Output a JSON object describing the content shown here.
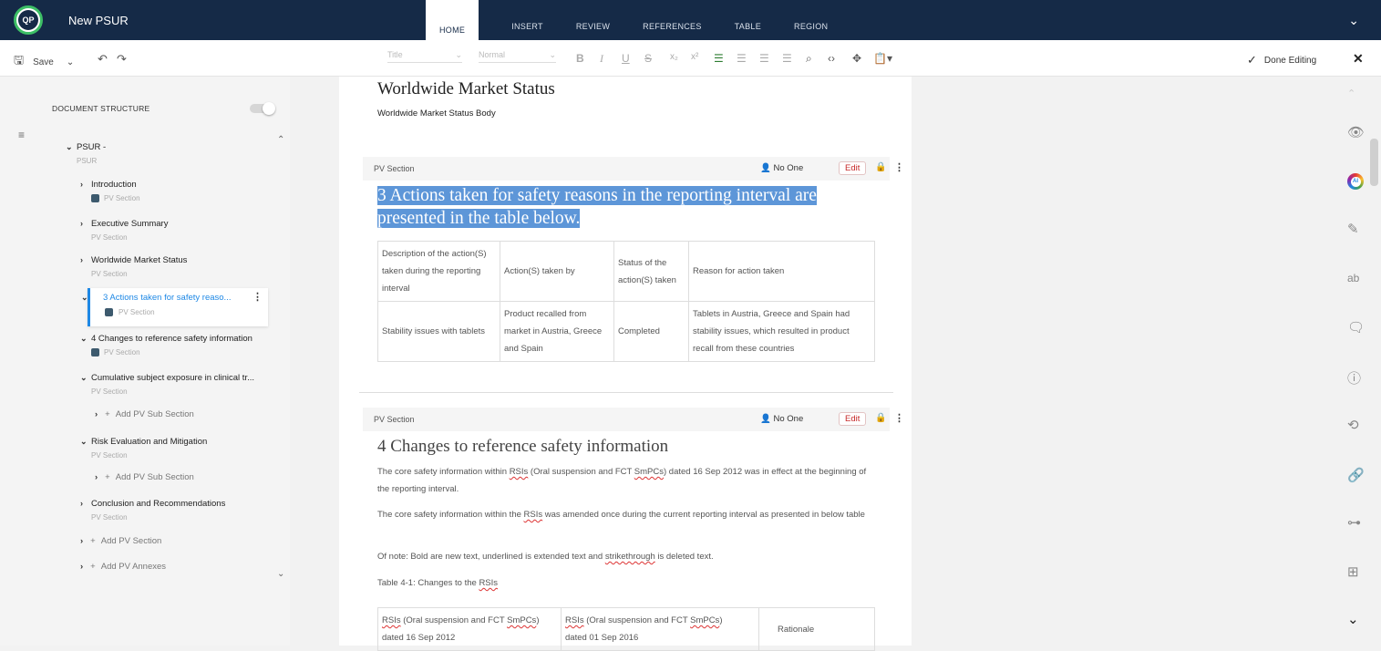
{
  "app": {
    "title": "New PSUR",
    "logo_text": "QP"
  },
  "tabs": [
    "HOME",
    "INSERT",
    "REVIEW",
    "REFERENCES",
    "TABLE",
    "REGION"
  ],
  "toolbar": {
    "save_label": "Save",
    "style_select": "Title",
    "para_select": "Normal",
    "done_label": "Done Editing"
  },
  "sidebar": {
    "header": "DOCUMENT STRUCTURE",
    "root": {
      "title": "PSUR -",
      "sub": "PSUR"
    },
    "items": [
      {
        "title": "Introduction",
        "sub": "PV Section"
      },
      {
        "title": "Executive Summary",
        "sub": "PV Section"
      },
      {
        "title": "Worldwide Market Status",
        "sub": "PV Section"
      },
      {
        "title": "3 Actions taken for safety reaso...",
        "sub": "PV Section"
      },
      {
        "title": "4 Changes to reference safety information",
        "sub": "PV Section"
      },
      {
        "title": "Cumulative subject exposure in clinical tr...",
        "sub": "PV Section"
      },
      {
        "title": "Risk Evaluation and Mitigation",
        "sub": "PV Section"
      },
      {
        "title": "Conclusion and Recommendations",
        "sub": "PV Section"
      }
    ],
    "add_sub_section": "Add PV Sub Section",
    "add_section": "Add PV Section",
    "add_annexes": "Add PV Annexes"
  },
  "document": {
    "heading1": "Worldwide Market Status",
    "body1": "Worldwide Market Status Body",
    "section_label": "PV Section",
    "owner": "No One",
    "edit_label": "Edit",
    "heading3": "3 Actions taken for safety reasons in the reporting interval are presented in the table below.",
    "table1": {
      "headers": [
        "Description of the action(S) taken during the reporting interval",
        "Action(S) taken by",
        "Status of the action(S) taken",
        "Reason for action taken"
      ],
      "row": [
        "Stability issues with tablets",
        "Product recalled from market in Austria, Greece and Spain",
        "Completed",
        "Tablets in Austria, Greece and Spain had stability issues, which resulted in product recall from these countries"
      ]
    },
    "heading4": "4 Changes to reference safety information",
    "para1_a": "The core safety information within ",
    "para1_rsis": "RSIs",
    "para1_b": " (Oral suspension and FCT ",
    "para1_smpcs": "SmPCs",
    "para1_c": ") dated 16 Sep 2012 was in effect at the beginning of the reporting interval.",
    "para2_a": "The core safety information within the ",
    "para2_rsis": "RSIs",
    "para2_b": " was amended once during the current reporting interval as presented in below table",
    "para3_a": "Of note: Bold are new text, underlined is extended text and ",
    "para3_strike": "strikethrough",
    "para3_b": " is deleted text.",
    "para4_a": "Table 4-1: Changes to the ",
    "para4_rsis": "RSIs",
    "table2": {
      "c1a": "RSIs",
      "c1b": " (Oral suspension and FCT ",
      "c1c": "SmPCs",
      "c1d": ")",
      "c1e": "dated 16 Sep 2012",
      "c2a": "RSIs",
      "c2b": " (Oral suspension and FCT ",
      "c2c": "SmPCs",
      "c2d": ")",
      "c2e": "dated 01 Sep 2016",
      "c3": "Rationale"
    }
  }
}
